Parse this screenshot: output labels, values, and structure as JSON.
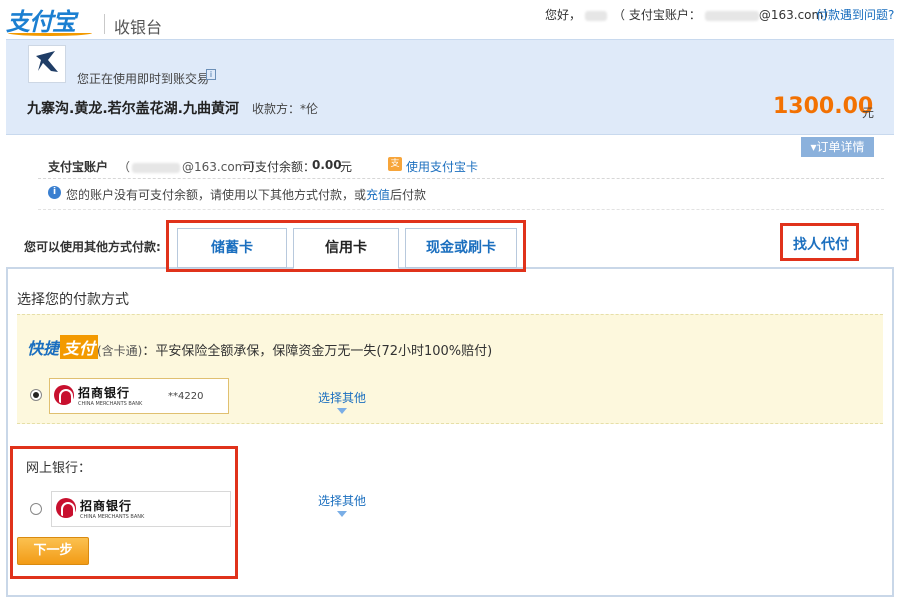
{
  "header": {
    "logo_text": "支付宝",
    "title": "收银台",
    "greeting": "您好，",
    "account_prefix": "（ 支付宝账户：",
    "account_suffix": "@163.com）",
    "help_link": "付款遇到问题?"
  },
  "order": {
    "instant_label": "您正在使用即时到账交易",
    "info_icon": "i",
    "product_name": "九寨沟.黄龙.若尔盖花湖.九曲黄河",
    "payee": "收款方：*伦",
    "amount": "1300.00",
    "amount_unit": "元",
    "detail_button": "▾订单详情"
  },
  "account": {
    "label": "支付宝账户",
    "masked_open": "（",
    "masked_suffix": "@163.com ）",
    "balance_label": "可支付余额：",
    "balance_value": "0.00",
    "balance_unit": "元",
    "treasure_icon": "支",
    "treasure_link": "使用支付宝卡",
    "notice_icon": "i",
    "notice_before": "您的账户没有可支付余额，请使用以下其他方式付款，或",
    "notice_link": "充值",
    "notice_after": "后付款"
  },
  "tabs": {
    "label": "您可以使用其他方式付款:",
    "items": [
      "储蓄卡",
      "信用卡",
      "现金或刷卡"
    ],
    "active": "信用卡",
    "proxy_pay": "找人代付"
  },
  "main": {
    "select_method": "选择您的付款方式",
    "quick": {
      "logo_a": "快捷",
      "logo_b": "支付",
      "sub": "(含卡通)",
      "desc": "：平安保险全额承保，保障资金万无一失(72小时100%赔付)",
      "bank_name": "招商银行",
      "bank_en": "CHINA MERCHANTS BANK",
      "card_tail": "**4220",
      "select_other": "选择其他"
    },
    "net": {
      "label": "网上银行：",
      "bank_name": "招商银行",
      "bank_en": "CHINA MERCHANTS BANK",
      "select_other": "选择其他"
    },
    "next_button": "下一步"
  },
  "colors": {
    "brand_blue": "#1b7fd1",
    "link_blue": "#1b6fbf",
    "amount_orange": "#f27102",
    "highlight_red": "#e0321b",
    "banner_bg": "#dfeaf9",
    "quick_bg": "#fdf8dd"
  }
}
